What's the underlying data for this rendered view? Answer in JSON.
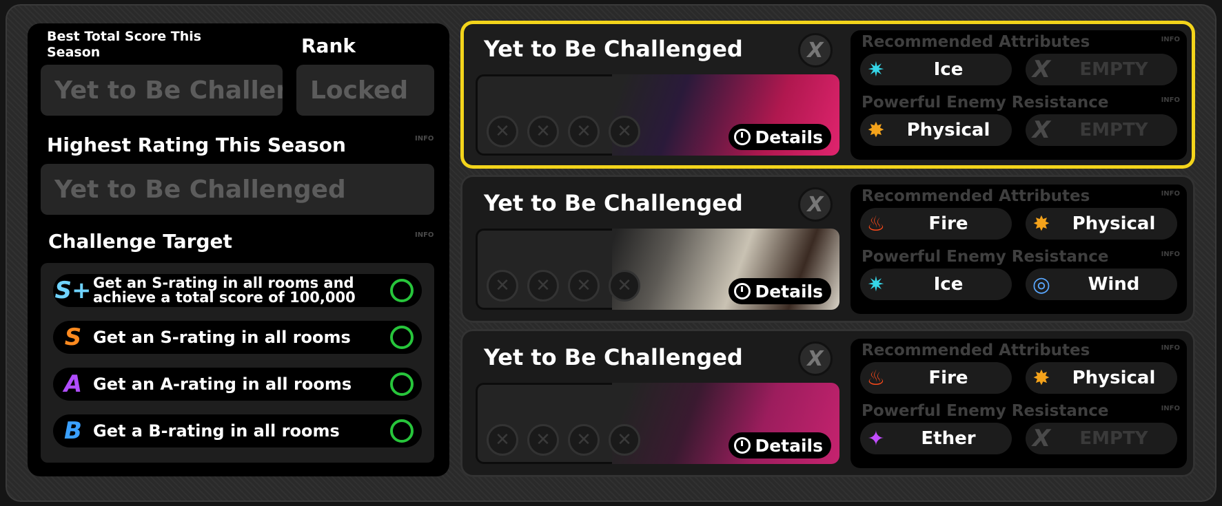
{
  "left": {
    "best_score_label": "Best Total Score This Season",
    "best_score_value": "Yet to Be Challeng",
    "rank_label": "Rank",
    "rank_value": "Locked",
    "highest_rating_label": "Highest Rating This Season",
    "highest_rating_value": "Yet to Be Challenged",
    "info": "INFO",
    "challenge_target_label": "Challenge Target",
    "targets": [
      {
        "grade": "S+",
        "text": "Get an S-rating in all rooms and achieve a total score of 100,000",
        "color": "#6fd3ff"
      },
      {
        "grade": "S",
        "text": "Get an S-rating in all rooms",
        "color": "#ff8a1f"
      },
      {
        "grade": "A",
        "text": "Get an A-rating in all rooms",
        "color": "#b04dff"
      },
      {
        "grade": "B",
        "text": "Get a B-rating in all rooms",
        "color": "#3aa0ff"
      }
    ]
  },
  "cards": [
    {
      "title": "Yet to Be Challenged",
      "x_label": "X",
      "details_label": "Details",
      "art_color": "#d01d6a",
      "selected": true,
      "recommended_label": "Recommended Attributes",
      "resistance_label": "Powerful Enemy Resistance",
      "info": "INFO",
      "recommended": [
        {
          "icon": "ice-icon",
          "label": "Ice",
          "empty": false
        },
        {
          "icon": "empty-x-icon",
          "label": "EMPTY",
          "empty": true
        }
      ],
      "resistance": [
        {
          "icon": "physical-icon",
          "label": "Physical",
          "empty": false
        },
        {
          "icon": "empty-x-icon",
          "label": "EMPTY",
          "empty": true
        }
      ]
    },
    {
      "title": "Yet to Be Challenged",
      "x_label": "X",
      "details_label": "Details",
      "art_color": "#c9c2b3",
      "selected": false,
      "recommended_label": "Recommended Attributes",
      "resistance_label": "Powerful Enemy Resistance",
      "info": "INFO",
      "recommended": [
        {
          "icon": "fire-icon",
          "label": "Fire",
          "empty": false
        },
        {
          "icon": "physical-icon",
          "label": "Physical",
          "empty": false
        }
      ],
      "resistance": [
        {
          "icon": "ice-icon",
          "label": "Ice",
          "empty": false
        },
        {
          "icon": "wind-icon",
          "label": "Wind",
          "empty": false
        }
      ]
    },
    {
      "title": "Yet to Be Challenged",
      "x_label": "X",
      "details_label": "Details",
      "art_color": "#b3206b",
      "selected": false,
      "recommended_label": "Recommended Attributes",
      "resistance_label": "Powerful Enemy Resistance",
      "info": "INFO",
      "recommended": [
        {
          "icon": "fire-icon",
          "label": "Fire",
          "empty": false
        },
        {
          "icon": "physical-icon",
          "label": "Physical",
          "empty": false
        }
      ],
      "resistance": [
        {
          "icon": "ether-icon",
          "label": "Ether",
          "empty": false
        },
        {
          "icon": "empty-x-icon",
          "label": "EMPTY",
          "empty": true
        }
      ]
    }
  ],
  "colors": {
    "ice": "#35d6e8",
    "fire": "#ff4a1a",
    "physical": "#f3a21b",
    "wind": "#5aa8ff",
    "ether": "#c24dff",
    "selected_border": "#f3d41b",
    "ring": "#27c53b"
  }
}
